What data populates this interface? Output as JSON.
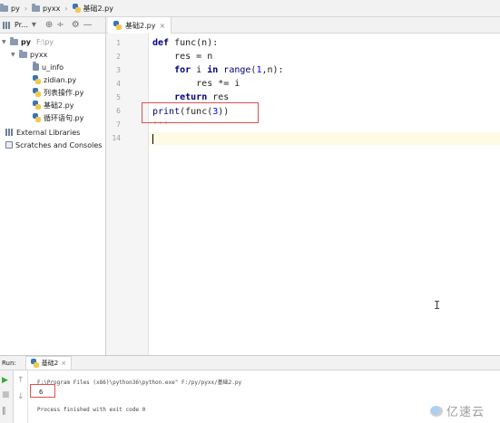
{
  "breadcrumb": [
    {
      "label": "py",
      "icon": "folder-icon"
    },
    {
      "label": "pyxx",
      "icon": "folder-icon"
    },
    {
      "label": "基础2.py",
      "icon": "python-file-icon"
    }
  ],
  "project_panel": {
    "title": "Pr...",
    "tree": [
      {
        "label": "py",
        "suffix": "F:\\py",
        "icon": "folder-icon",
        "expanded": true
      },
      {
        "label": "pyxx",
        "icon": "folder-icon",
        "expanded": true
      },
      {
        "label": "u_info",
        "icon": "module-icon"
      },
      {
        "label": "zidian.py",
        "icon": "python-file-icon"
      },
      {
        "label": "列表操作.py",
        "icon": "python-file-icon"
      },
      {
        "label": "基础2.py",
        "icon": "python-file-icon"
      },
      {
        "label": "循环语句.py",
        "icon": "python-file-icon"
      },
      {
        "label": "External Libraries",
        "icon": "library-icon"
      },
      {
        "label": "Scratches and Consoles",
        "icon": "scratch-icon"
      }
    ]
  },
  "editor": {
    "tab_label": "基础2.py",
    "line_numbers": [
      "1",
      "2",
      "3",
      "4",
      "5",
      "6",
      "7",
      "14"
    ],
    "code_lines": [
      "def func(n):",
      "    res = n",
      "    for i in range(1,n):",
      "        res *= i",
      "    return res",
      "print(func(3))",
      "'''",
      ""
    ]
  },
  "run_panel": {
    "label": "Run:",
    "tab_label": "基础2",
    "command": "F:\\Program Files (x86)\\python36\\python.exe\" F:/py/pyxx/基础2.py",
    "output": "6",
    "status": "Process finished with exit code 0"
  },
  "watermark": {
    "text": "亿速云"
  },
  "colors": {
    "keyword": "#000080",
    "number": "#0000ff",
    "highlight_box": "#e05050",
    "current_line": "#fffae3",
    "run_green": "#3aa63a"
  }
}
